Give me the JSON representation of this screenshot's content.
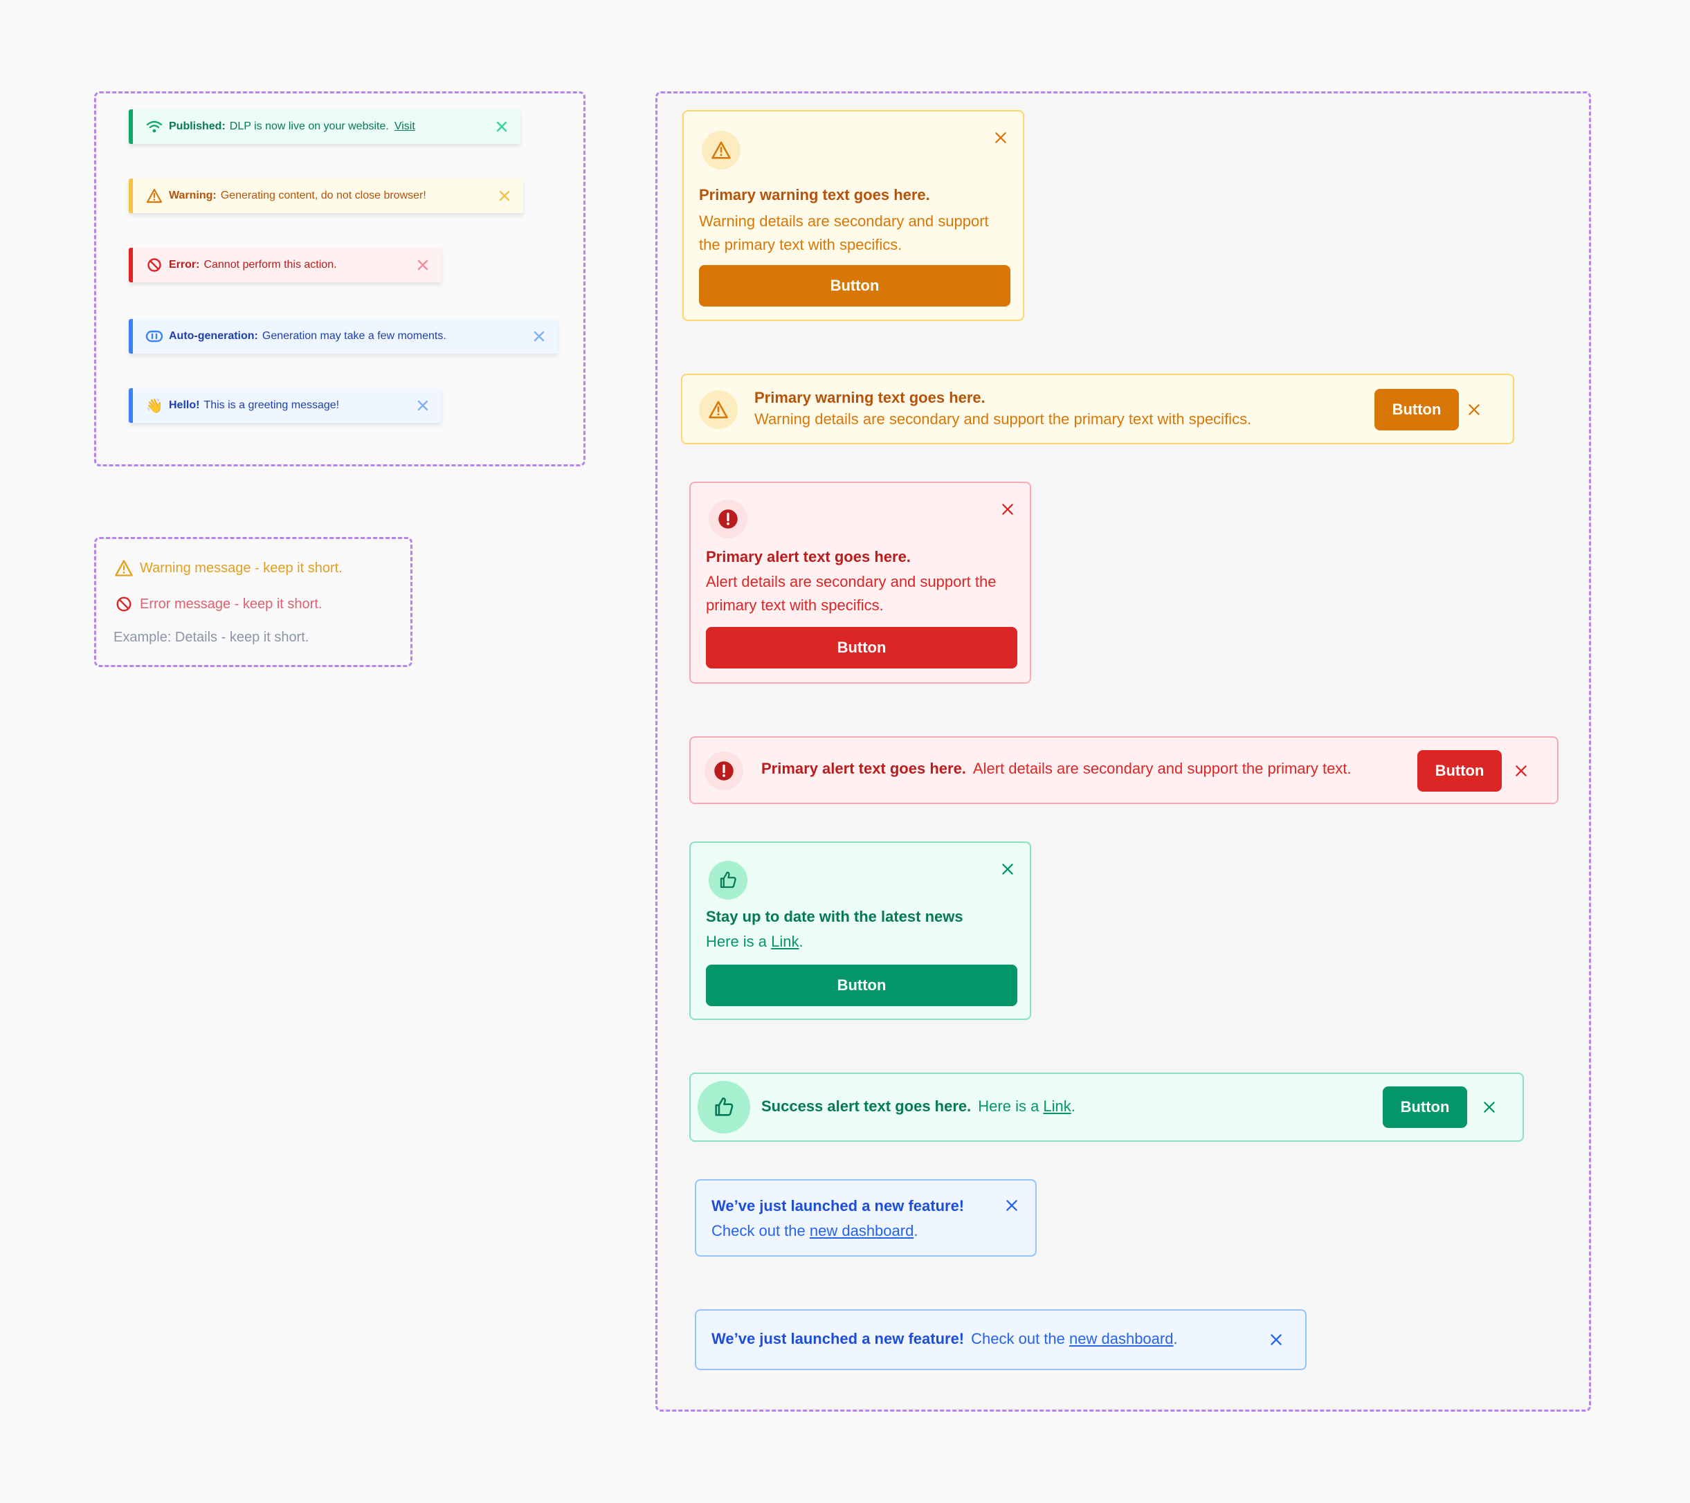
{
  "toasts": [
    {
      "id": "published",
      "title": "Published:",
      "text": "DLP is now live on your website.",
      "link": "Visit",
      "icon": "wifi-icon",
      "color": "#10a76d"
    },
    {
      "id": "warning",
      "title": "Warning:",
      "text": "Generating content, do not close browser!",
      "icon": "warning-triangle-icon",
      "color": "#f6c244"
    },
    {
      "id": "error",
      "title": "Error:",
      "text": "Cannot perform this action.",
      "icon": "prohibited-icon",
      "color": "#dc2626"
    },
    {
      "id": "auto",
      "title": "Auto-generation:",
      "text": "Generation may take a few moments.",
      "icon": "robot-icon",
      "color": "#3b82f6"
    },
    {
      "id": "hello",
      "title": "Hello!",
      "text": "This is a greeting message!",
      "icon": "waving-hand-icon",
      "emoji": "👋",
      "color": "#3b82f6"
    }
  ],
  "inline_messages": {
    "warning": "Warning message - keep it short.",
    "error": "Error message - keep it short.",
    "example": "Example: Details - keep it short."
  },
  "alerts": {
    "warn_card": {
      "title": "Primary warning text goes here.",
      "body": "Warning details are secondary and support the primary text with specifics.",
      "button": "Button"
    },
    "warn_bar": {
      "title": "Primary warning text goes here.",
      "body": "Warning details are secondary and support the primary text with specifics.",
      "button": "Button"
    },
    "danger_card": {
      "title": "Primary alert text goes here.",
      "body": "Alert details are secondary and support the primary text with specifics.",
      "button": "Button"
    },
    "danger_bar": {
      "title": "Primary alert text goes here.",
      "body": "Alert details are secondary and support the primary text.",
      "button": "Button"
    },
    "success_card": {
      "title": "Stay up to date with the latest news",
      "body_prefix": "Here is a ",
      "link": "Link",
      "body_suffix": ".",
      "button": "Button"
    },
    "success_bar": {
      "title": "Success alert text goes here.",
      "body_prefix": "Here is a ",
      "link": "Link",
      "body_suffix": ".",
      "button": "Button"
    },
    "info_card": {
      "title": "We’ve just launched a new feature!",
      "body_prefix": "Check out the ",
      "link": "new dashboard",
      "body_suffix": "."
    },
    "info_bar": {
      "title": "We’ve just launched a new feature!",
      "body_prefix": "Check out the ",
      "link": "new dashboard",
      "body_suffix": "."
    }
  },
  "colors": {
    "warning": "#d97706",
    "danger": "#dc2626",
    "success": "#059669",
    "info": "#2563eb",
    "frame": "#b683f0"
  }
}
